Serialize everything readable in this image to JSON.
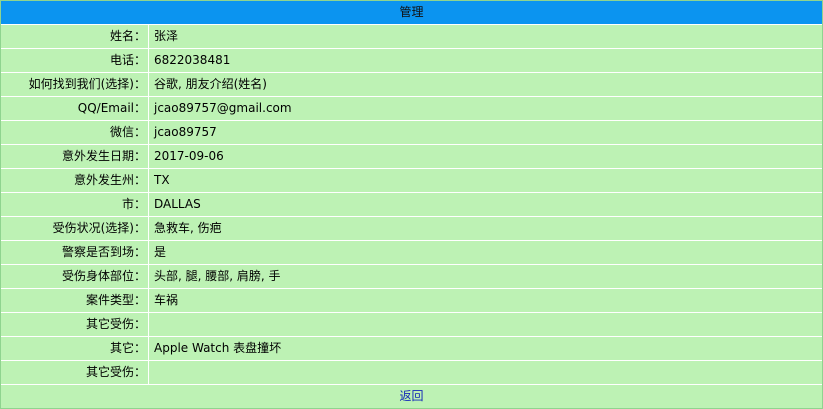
{
  "header": {
    "title": "管理"
  },
  "rows": [
    {
      "label": "姓名：",
      "value": "张泽"
    },
    {
      "label": "电话：",
      "value": "6822038481"
    },
    {
      "label": "如何找到我们(选择)：",
      "value": "谷歌, 朋友介绍(姓名)"
    },
    {
      "label": "QQ/Email：",
      "value": "jcao89757@gmail.com"
    },
    {
      "label": "微信：",
      "value": "jcao89757"
    },
    {
      "label": "意外发生日期：",
      "value": "2017-09-06"
    },
    {
      "label": "意外发生州：",
      "value": "TX"
    },
    {
      "label": "市：",
      "value": "DALLAS"
    },
    {
      "label": "受伤状况(选择)：",
      "value": "急救车, 伤疤"
    },
    {
      "label": "警察是否到场：",
      "value": "是"
    },
    {
      "label": "受伤身体部位：",
      "value": "头部, 腿, 腰部, 肩膀, 手"
    },
    {
      "label": "案件类型：",
      "value": "车祸"
    },
    {
      "label": "其它受伤：",
      "value": ""
    },
    {
      "label": "其它：",
      "value": "Apple Watch 表盘撞坏"
    },
    {
      "label": "其它受伤：",
      "value": ""
    }
  ],
  "footer": {
    "back_label": "返回"
  },
  "colors": {
    "header_bg": "#0b94f0",
    "row_bg": "#bdf2b4",
    "link": "#1428b8"
  }
}
